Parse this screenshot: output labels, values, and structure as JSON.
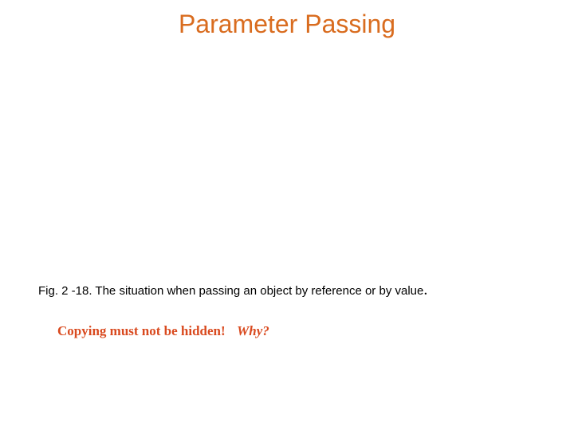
{
  "title": "Parameter Passing",
  "caption": {
    "text": "Fig. 2 -18. The situation when passing an object by reference or by value",
    "period": "."
  },
  "emphasis": {
    "warning": "Copying must not be hidden!",
    "question": "Why?"
  }
}
